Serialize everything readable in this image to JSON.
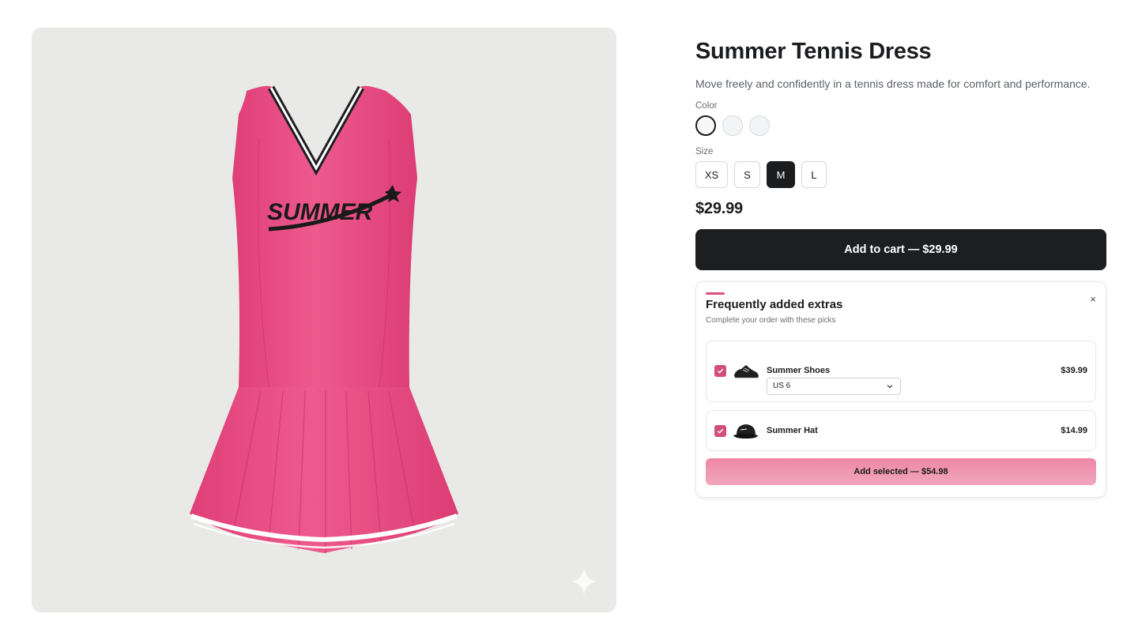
{
  "product": {
    "title": "Summer Tennis Dress",
    "description": "Move freely and confidently in a tennis dress made for comfort and performance.",
    "image_print_text": "SUMMER",
    "color_label": "Color",
    "colors": [
      "#f7f7f7",
      "#f3f4f5",
      "#f3f4f5"
    ],
    "selected_color_index": 0,
    "size_label": "Size",
    "sizes": [
      "XS",
      "S",
      "M",
      "L"
    ],
    "selected_size": "M",
    "price": "$29.99",
    "add_to_cart_label": "Add to cart — $29.99"
  },
  "extras": {
    "title": "Frequently added extras",
    "subtitle": "Complete your order with these picks",
    "close_icon": "×",
    "items": [
      {
        "name": "Summer Shoes",
        "price": "$39.99",
        "checked": true,
        "option_value": "US 6"
      },
      {
        "name": "Summer Hat",
        "price": "$14.99",
        "checked": true
      }
    ],
    "add_selected_label": "Add selected — $54.98"
  },
  "colors": {
    "accent": "#e0507e",
    "dress_pink": "#ea4f84",
    "dark": "#1d1e20",
    "checkbox": "#d14e7b"
  }
}
